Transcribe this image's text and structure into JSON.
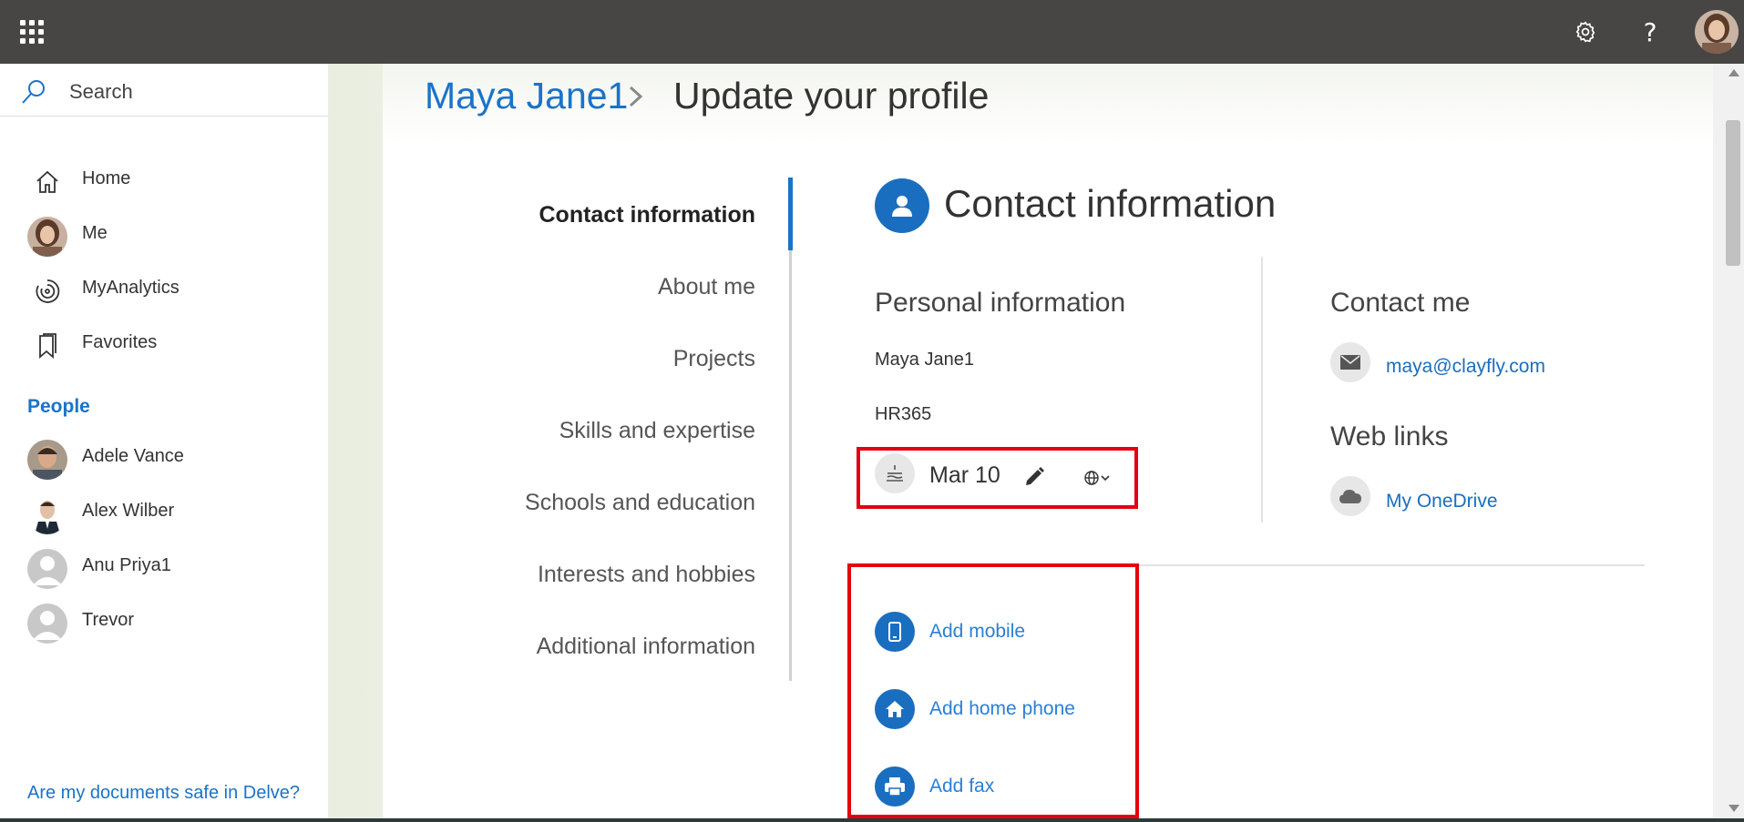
{
  "topbar": {
    "help_label": "?"
  },
  "sidebar": {
    "search_label": "Search",
    "nav": [
      {
        "label": "Home",
        "icon": "home-icon"
      },
      {
        "label": "Me",
        "icon": "avatar"
      },
      {
        "label": "MyAnalytics",
        "icon": "analytics-icon"
      },
      {
        "label": "Favorites",
        "icon": "bookmark-icon"
      }
    ],
    "people_heading": "People",
    "people": [
      {
        "label": "Adele Vance"
      },
      {
        "label": "Alex Wilber"
      },
      {
        "label": "Anu Priya1"
      },
      {
        "label": "Trevor"
      }
    ],
    "bottom_link": "Are my documents safe in Delve?"
  },
  "breadcrumb": {
    "name": "Maya Jane1",
    "separator": ">",
    "title": "Update your profile"
  },
  "sections": [
    {
      "label": "Contact information",
      "active": true
    },
    {
      "label": "About me",
      "active": false
    },
    {
      "label": "Projects",
      "active": false
    },
    {
      "label": "Skills and expertise",
      "active": false
    },
    {
      "label": "Schools and education",
      "active": false
    },
    {
      "label": "Interests and hobbies",
      "active": false
    },
    {
      "label": "Additional information",
      "active": false
    }
  ],
  "contact": {
    "title": "Contact information",
    "personal_heading": "Personal information",
    "name": "Maya Jane1",
    "company": "HR365",
    "birthday": "Mar 10",
    "contact_me_heading": "Contact me",
    "email": "maya@clayfly.com",
    "web_links_heading": "Web links",
    "onedrive": "My OneDrive",
    "add_mobile": "Add mobile",
    "add_home_phone": "Add home phone",
    "add_fax": "Add fax"
  },
  "colors": {
    "accent": "#1a73c8",
    "topbar": "#484644",
    "highlight": "#e3000f"
  }
}
